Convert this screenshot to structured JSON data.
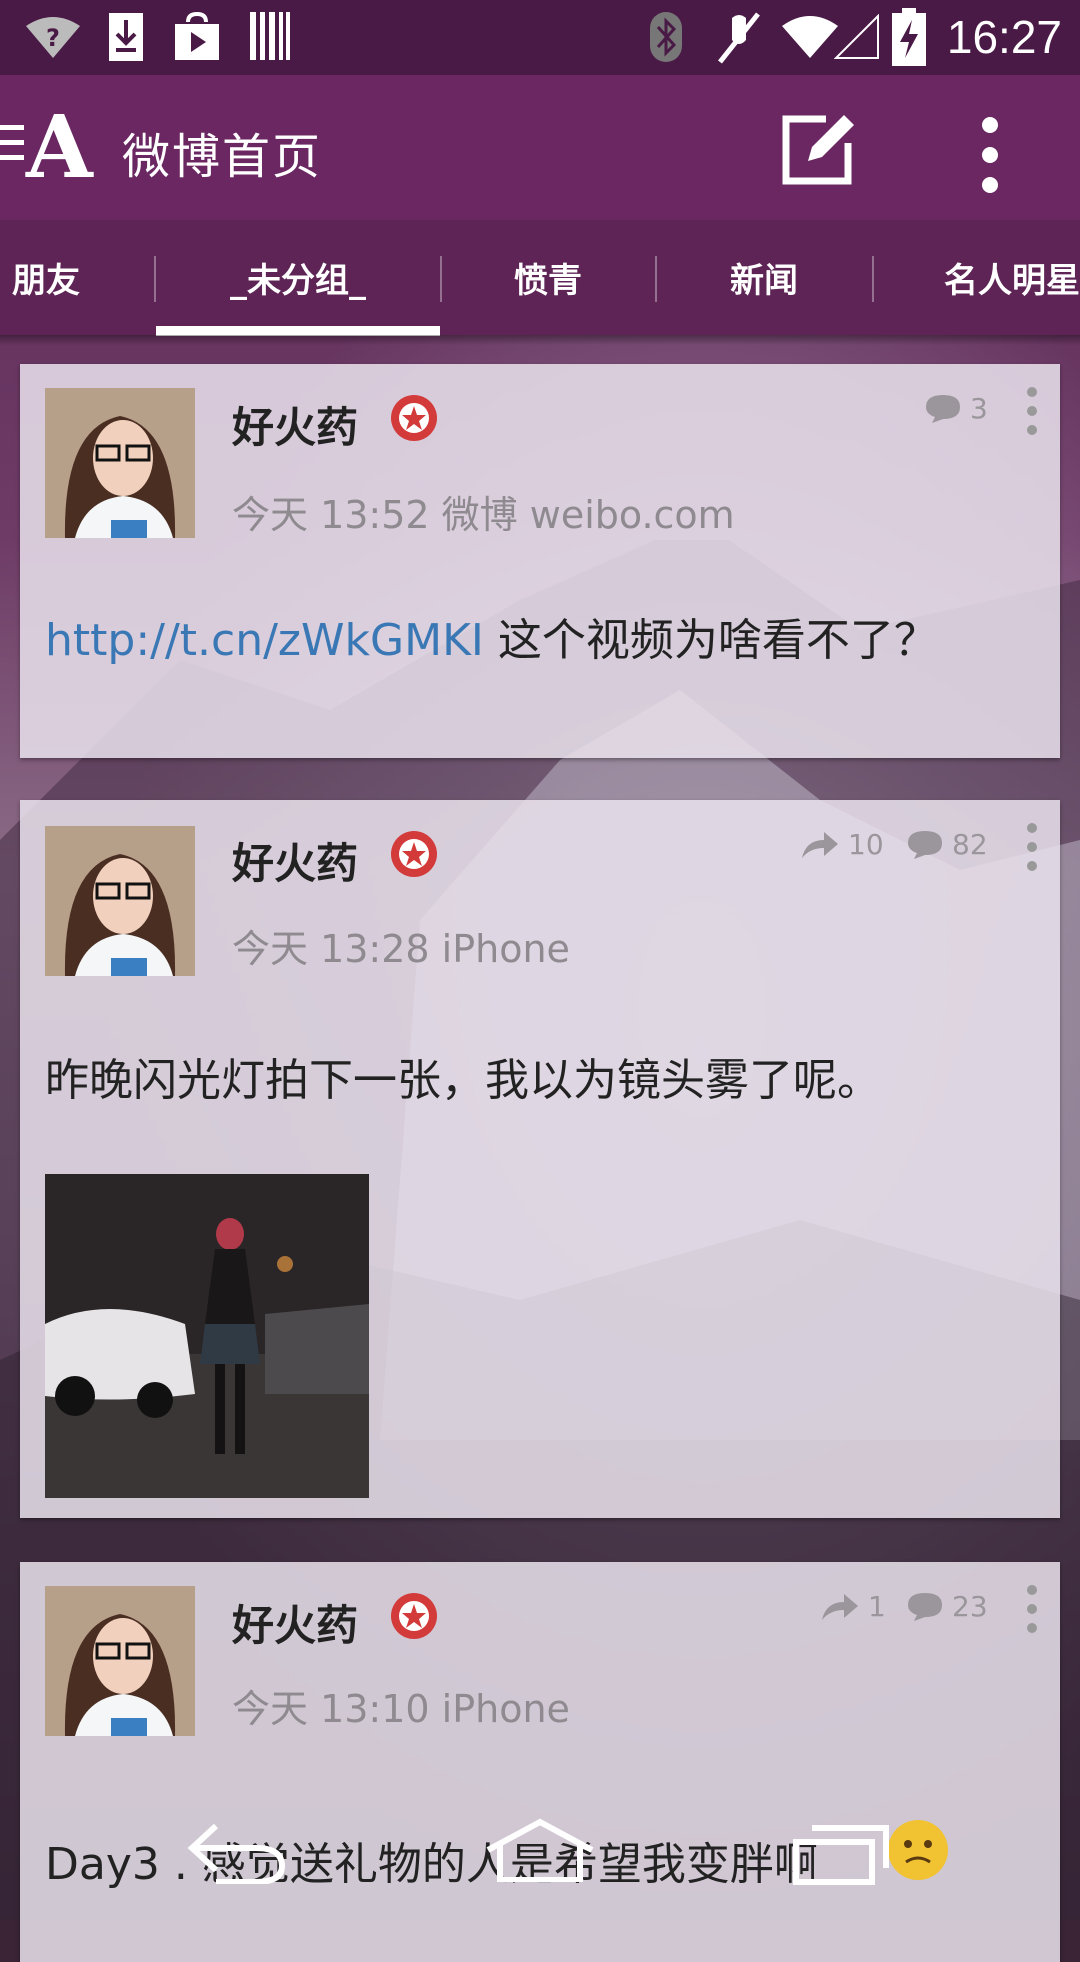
{
  "status_bar": {
    "time": "16:27",
    "icons": [
      "wifi-question-icon",
      "download-icon",
      "play-store-icon",
      "barcode-icon",
      "bluetooth-icon",
      "mute-icon",
      "wifi-icon",
      "signal-icon",
      "battery-charging-icon"
    ]
  },
  "app_bar": {
    "title": "微博首页",
    "logo_letter": "A"
  },
  "tabs": [
    {
      "label": "朋友",
      "active": false
    },
    {
      "label": "_未分组_",
      "active": true
    },
    {
      "label": "愤青",
      "active": false
    },
    {
      "label": "新闻",
      "active": false
    },
    {
      "label": "名人明星",
      "active": false
    }
  ],
  "posts": [
    {
      "author": "好火药",
      "meta": "今天 13:52 微博 weibo.com",
      "comments": "3",
      "link": "http://t.cn/zWkGMKI",
      "text": " 这个视频为啥看不了？"
    },
    {
      "author": "好火药",
      "meta": "今天 13:28 iPhone",
      "reposts": "10",
      "comments": "82",
      "text": "昨晚闪光灯拍下一张，我以为镜头雾了呢。"
    },
    {
      "author": "好火药",
      "meta": "今天 13:10 iPhone",
      "reposts": "1",
      "comments": "23",
      "text": "Day3 . 感觉送礼物的人是希望我变胖啊"
    }
  ],
  "colors": {
    "status_bar": "#4a1a46",
    "app_bar": "#6a2762",
    "tabs": "#5e2455",
    "link": "#3a78b5",
    "badge": "#d33a3a"
  }
}
